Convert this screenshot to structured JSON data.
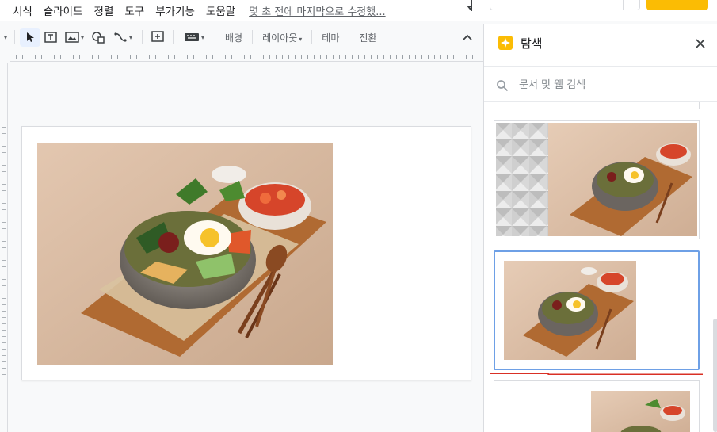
{
  "menu": {
    "items": [
      "서식",
      "슬라이드",
      "정렬",
      "도구",
      "부가기능",
      "도움말"
    ],
    "last_edit": "몇 초 전에 마지막으로 수정했..."
  },
  "toolbar": {
    "background": "배경",
    "layout": "레이아웃",
    "theme": "테마",
    "transition": "전환"
  },
  "panel": {
    "title": "탐색",
    "search_placeholder": "문서 및 웹 검색"
  },
  "colors": {
    "accent_yellow": "#fbbc04",
    "selection_blue": "#6ea0e6",
    "underline_red": "#d93025"
  }
}
